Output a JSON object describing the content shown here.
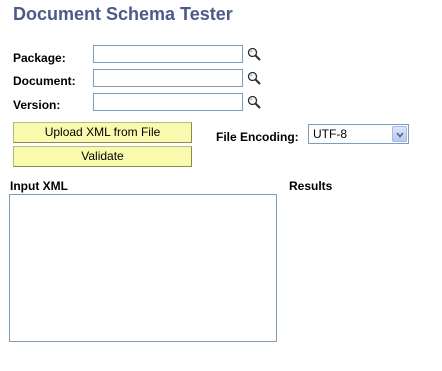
{
  "page": {
    "title": "Document Schema Tester"
  },
  "form": {
    "package": {
      "label": "Package:",
      "value": ""
    },
    "document": {
      "label": "Document:",
      "value": ""
    },
    "version": {
      "label": "Version:",
      "value": ""
    }
  },
  "buttons": {
    "upload": "Upload XML from File",
    "validate": "Validate"
  },
  "encoding": {
    "label": "File Encoding:",
    "value": "UTF-8"
  },
  "sections": {
    "input": "Input XML",
    "results": "Results"
  },
  "icons": {
    "lookup": "magnifier-icon",
    "dropdown": "chevron-down-icon"
  }
}
